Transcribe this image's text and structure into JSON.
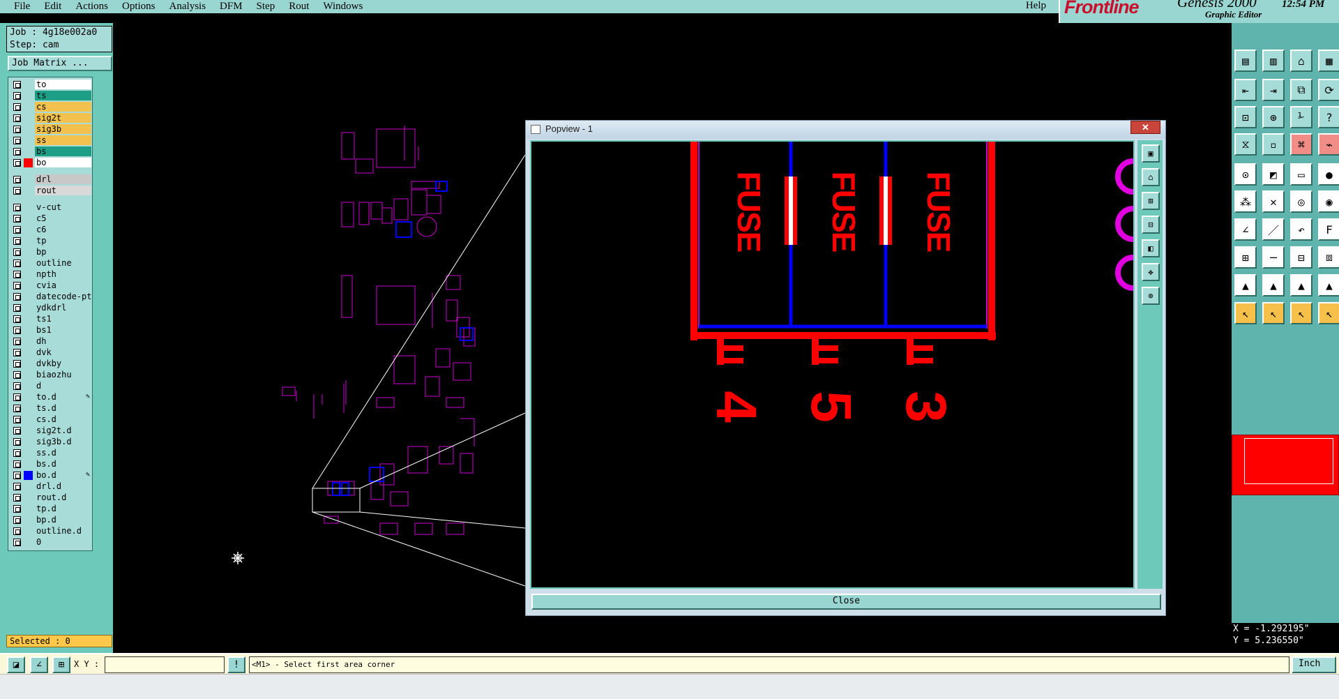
{
  "menu": {
    "items": [
      "File",
      "Edit",
      "Actions",
      "Options",
      "Analysis",
      "DFM",
      "Step",
      "Rout",
      "Windows"
    ],
    "help": "Help"
  },
  "brand": {
    "logo": "Frontline",
    "product": "Genesis 2000",
    "subtitle": "Graphic Editor",
    "clock": "12:54 PM"
  },
  "job": {
    "job_line": "Job : 4g18e002a0",
    "step_line": "Step: cam",
    "matrix_label": "Job Matrix ..."
  },
  "layers": [
    {
      "name": "to",
      "fill": "#ffffff"
    },
    {
      "name": "ts",
      "fill": "#1f9e86"
    },
    {
      "name": "cs",
      "fill": "#f2c14e"
    },
    {
      "name": "sig2t",
      "fill": "#f2c14e"
    },
    {
      "name": "sig3b",
      "fill": "#f2c14e"
    },
    {
      "name": "ss",
      "fill": "#f2c14e"
    },
    {
      "name": "bs",
      "fill": "#1f9e86"
    },
    {
      "name": "bo",
      "fill": "#ffffff",
      "swatch": "#ff0000",
      "active": true
    },
    {
      "name": "drl",
      "fill": "#c8c8c8"
    },
    {
      "name": "rout",
      "fill": "#d9d9d9"
    },
    {
      "name": "v-cut"
    },
    {
      "name": "c5"
    },
    {
      "name": "c6"
    },
    {
      "name": "tp"
    },
    {
      "name": "bp"
    },
    {
      "name": "outline"
    },
    {
      "name": "npth"
    },
    {
      "name": "cvia"
    },
    {
      "name": "datecode-pt"
    },
    {
      "name": "ydkdrl"
    },
    {
      "name": "ts1"
    },
    {
      "name": "bs1"
    },
    {
      "name": "dh"
    },
    {
      "name": "dvk"
    },
    {
      "name": "dvkby"
    },
    {
      "name": "biaozhu"
    },
    {
      "name": "d"
    },
    {
      "name": "to.d",
      "pen": true
    },
    {
      "name": "ts.d"
    },
    {
      "name": "cs.d"
    },
    {
      "name": "sig2t.d"
    },
    {
      "name": "sig3b.d"
    },
    {
      "name": "ss.d"
    },
    {
      "name": "bs.d"
    },
    {
      "name": "bo.d",
      "swatch": "#0000ff",
      "pen": true
    },
    {
      "name": "drl.d"
    },
    {
      "name": "rout.d"
    },
    {
      "name": "tp.d"
    },
    {
      "name": "bp.d"
    },
    {
      "name": "outline.d"
    },
    {
      "name": "0"
    }
  ],
  "selected": "Selected : 0",
  "bottom": {
    "xy_label": "X Y :",
    "xy_value": "",
    "status": "<M1> - Select first area corner",
    "units": "Inch"
  },
  "coords": {
    "x": "X = -1.292195\"",
    "y": "Y = 5.236550\""
  },
  "popview": {
    "title": "Popview - 1",
    "close_label": "Close",
    "window_close": "✕",
    "fuse_text": "FUSE",
    "ref_numbers": [
      "4",
      "5",
      "3"
    ]
  },
  "colors": {
    "bg": "#000000",
    "panel": "#6dc9b9",
    "copper": "#ff0000",
    "outline": "#cc00cc",
    "overlay": "#0000ff"
  }
}
